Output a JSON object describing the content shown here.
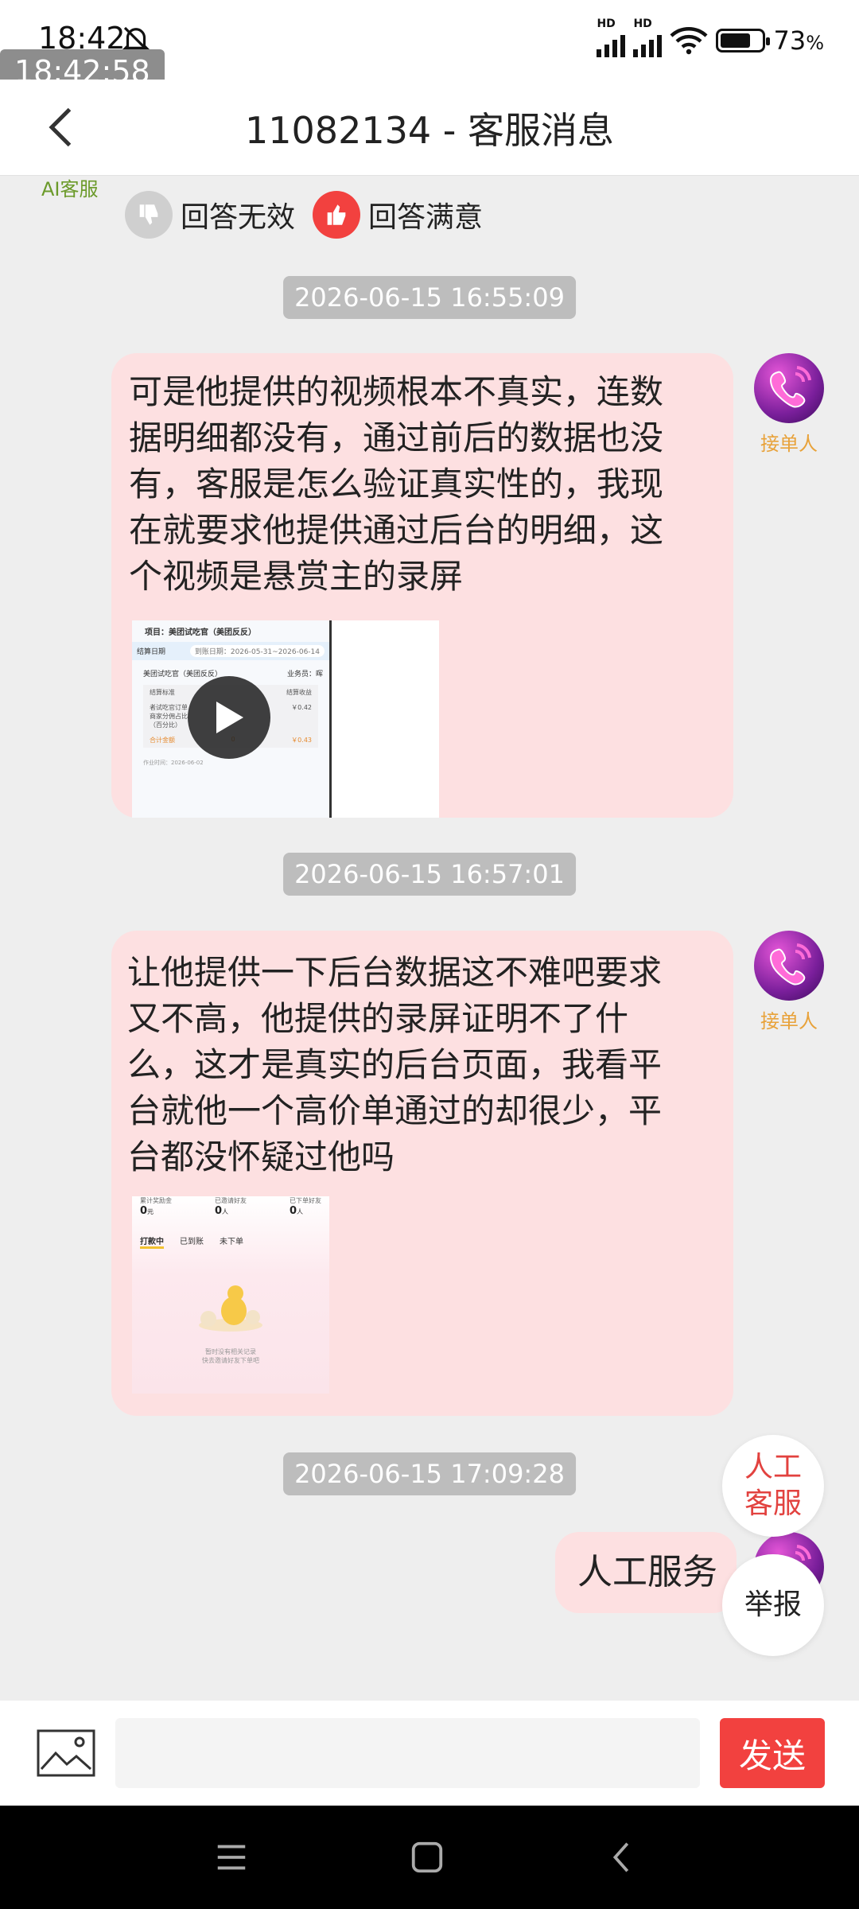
{
  "status_bar": {
    "time": "18:42",
    "network_label": "HD",
    "battery_percent": "73",
    "battery_unit": "%",
    "battery_level": 0.73,
    "overlay_clock": "18:42:58"
  },
  "header": {
    "title": "11082134 - 客服消息"
  },
  "chat": {
    "ai_label": "AI客服",
    "feedback": {
      "invalid_label": "回答无效",
      "satisfied_label": "回答满意"
    },
    "timestamps": [
      "2026-06-15 16:55:09",
      "2026-06-15 16:57:01",
      "2026-06-15 17:09:28"
    ],
    "messages": [
      {
        "sender": "接单人",
        "text": "可是他提供的视频根本不真实，连数据明细都没有，通过前后的数据也没有，客服是怎么验证真实性的，我现在就要求他提供通过后台的明细，这个视频是悬赏主的录屏",
        "attachment": {
          "type": "video",
          "project": "项目：美团试吃官（美团反反）",
          "settle_date_label": "结算日期",
          "date_range": "到账日期：2026-05-31~2026-06-14",
          "app_name": "美团试吃官（美团反反）",
          "staff": "业务员：晖",
          "col_standard": "结算标准",
          "col_income": "结算收益",
          "row_text": "者试吃官订单商家分佣占比（百分比）",
          "row_value": "￥0.42",
          "total_label": "合计金额",
          "total_count": "0",
          "total_value": "￥0.43",
          "footer": "作业时间：2026-06-02"
        }
      },
      {
        "sender": "接单人",
        "text": "让他提供一下后台数据这不难吧要求又不高，他提供的录屏证明不了什么，这才是真实的后台页面，我看平台就他一个高价单通过的却很少，平台都没怀疑过他吗",
        "attachment": {
          "type": "image",
          "stats": [
            {
              "label": "累计奖励金",
              "value": "0",
              "unit": "元"
            },
            {
              "label": "已邀请好友",
              "value": "0",
              "unit": "人"
            },
            {
              "label": "已下单好友",
              "value": "0",
              "unit": "人"
            }
          ],
          "tabs": [
            "打款中",
            "已到账",
            "未下单"
          ],
          "empty_line1": "暂时没有相关记录",
          "empty_line2": "快去邀请好友下单吧"
        }
      },
      {
        "sender": "me",
        "text": "人工服务"
      }
    ]
  },
  "float_buttons": {
    "human_service_line1": "人工",
    "human_service_line2": "客服",
    "report": "举报"
  },
  "input_bar": {
    "placeholder": "",
    "send_label": "发送"
  }
}
